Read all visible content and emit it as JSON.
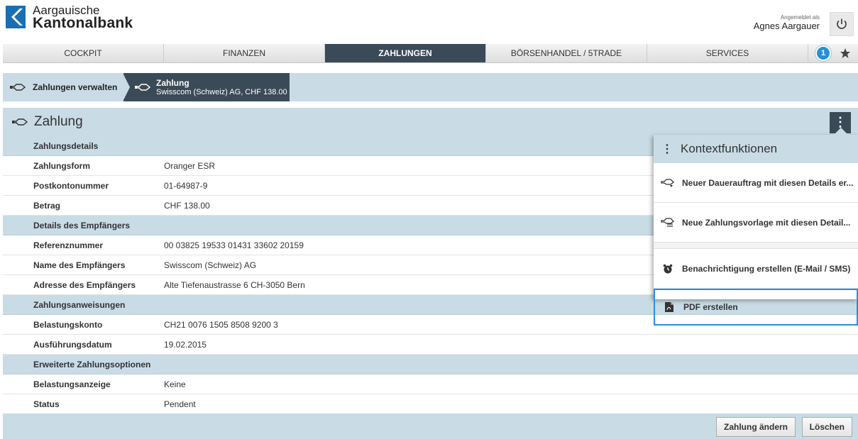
{
  "brand": {
    "line1": "Aargauische",
    "line2": "Kantonalbank",
    "color": "#1a6fb3"
  },
  "user": {
    "label": "Angemeldet als",
    "name": "Agnes Aargauer",
    "logout_icon": "power-icon"
  },
  "nav": {
    "tabs": [
      {
        "label": "COCKPIT",
        "active": false
      },
      {
        "label": "FINANZEN",
        "active": false
      },
      {
        "label": "ZAHLUNGEN",
        "active": true
      },
      {
        "label": "BÖRSENHANDEL / 5TRADE",
        "active": false
      },
      {
        "label": "SERVICES",
        "active": false
      }
    ],
    "notification_count": "1",
    "favorite_icon": "star-icon"
  },
  "breadcrumb": {
    "item1": "Zahlungen verwalten",
    "item2_title": "Zahlung",
    "item2_sub": "Swisscom (Schweiz) AG, CHF 138.00"
  },
  "panel": {
    "title": "Zahlung",
    "menu_icon": "more-vertical-icon"
  },
  "sections": {
    "s1": "Zahlungsdetails",
    "s2": "Details des Empfängers",
    "s3": "Zahlungsanweisungen",
    "s4": "Erweiterte Zahlungsoptionen"
  },
  "rows": {
    "zahlungsform": {
      "label": "Zahlungsform",
      "value": "Oranger ESR"
    },
    "postkonto": {
      "label": "Postkontonummer",
      "value": "01-64987-9"
    },
    "betrag": {
      "label": "Betrag",
      "value": "CHF 138.00"
    },
    "referenz": {
      "label": "Referenznummer",
      "value": "00 03825 19533 01431 33602 20159"
    },
    "name": {
      "label": "Name des Empfängers",
      "value": "Swisscom (Schweiz) AG"
    },
    "adresse": {
      "label": "Adresse des Empfängers",
      "value": "Alte Tiefenaustrasse 6 CH-3050 Bern"
    },
    "belastungskonto": {
      "label": "Belastungskonto",
      "value": "CH21 0076 1505 8508 9200 3"
    },
    "datum": {
      "label": "Ausführungsdatum",
      "value": "19.02.2015"
    },
    "anzeige": {
      "label": "Belastungsanzeige",
      "value": "Keine"
    },
    "status": {
      "label": "Status",
      "value": "Pendent"
    }
  },
  "context_menu": {
    "title": "Kontextfunktionen",
    "items": [
      {
        "label": "Neuer Dauerauftrag mit diesen Details er...",
        "icon": "standing-order-icon"
      },
      {
        "label": "Neue Zahlungsvorlage mit diesen Detail...",
        "icon": "payment-template-icon"
      },
      {
        "label": "Benachrichtigung erstellen (E-Mail / SMS)",
        "icon": "alarm-clock-icon"
      },
      {
        "label": "PDF erstellen",
        "icon": "pdf-icon"
      }
    ]
  },
  "buttons": {
    "edit": "Zahlung ändern",
    "delete": "Löschen"
  },
  "colors": {
    "nav_active": "#3b4a57",
    "section_bg": "#c9dce6",
    "accent": "#2a8fd8"
  }
}
